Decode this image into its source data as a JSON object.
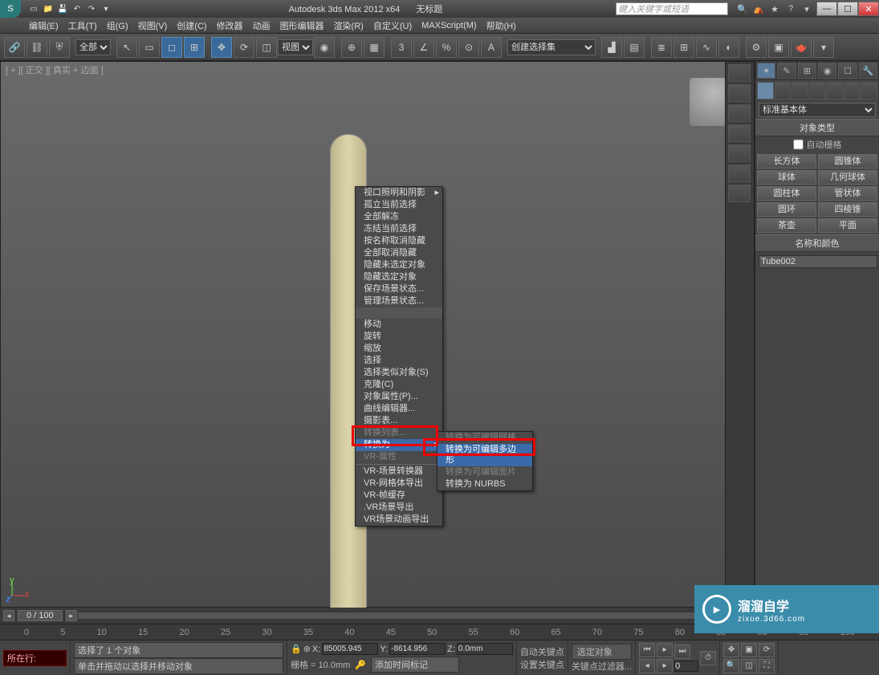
{
  "titlebar": {
    "title": "Autodesk 3ds Max  2012 x64",
    "doc": "无标题",
    "search_placeholder": "键入关键字或短语"
  },
  "menubar": [
    "编辑(E)",
    "工具(T)",
    "组(G)",
    "视图(V)",
    "创建(C)",
    "修改器",
    "动画",
    "图形编辑器",
    "渲染(R)",
    "自定义(U)",
    "MAXScript(M)",
    "帮助(H)"
  ],
  "toolbar": {
    "sel_filter": "全部",
    "ref_coord": "视图",
    "named_sets": "创建选择集"
  },
  "viewport": {
    "label": "[ + ][ 正交 ][ 真实 + 边面 ]"
  },
  "contextmenu": {
    "g1": [
      "视口照明和阴影",
      "孤立当前选择",
      "全部解冻",
      "冻结当前选择",
      "按名称取消隐藏",
      "全部取消隐藏",
      "隐藏未选定对象",
      "隐藏选定对象",
      "保存场景状态...",
      "管理场景状态..."
    ],
    "g2": [
      "移动",
      "旋转",
      "缩放",
      "选择",
      "选择类似对象(S)",
      "克隆(C)",
      "对象属性(P)...",
      "曲线编辑器...",
      "摄影表..."
    ],
    "g2b_hidden_top": "转换列表...",
    "g2b_highlight": "转换为",
    "g2b_hidden_bot": "VR-属性",
    "g3": [
      "VR-场景转换器",
      "VR-网格体导出",
      "VR-帧缓存",
      ".VR场景导出",
      "VR场景动画导出"
    ],
    "sub_hidden_top": "转换为可编辑网格",
    "sub_highlight": "转换为可编辑多边形",
    "sub_hidden_mid": "转换为可编辑面片",
    "sub_last": "转换为 NURBS"
  },
  "panel": {
    "category": "标准基本体",
    "roll_objtype": "对象类型",
    "autogrid": "自动栅格",
    "prims": [
      "长方体",
      "圆锥体",
      "球体",
      "几何球体",
      "圆柱体",
      "管状体",
      "圆环",
      "四棱锥",
      "茶壶",
      "平面"
    ],
    "roll_namecolor": "名称和颜色",
    "object_name": "Tube002"
  },
  "time": {
    "frame": "0 / 100",
    "marks": [
      "0",
      "5",
      "10",
      "15",
      "20",
      "25",
      "30",
      "35",
      "40",
      "45",
      "50",
      "55",
      "60",
      "65",
      "70",
      "75",
      "80",
      "85",
      "90",
      "95",
      "100"
    ]
  },
  "status": {
    "mscript_label": "所在行:",
    "sel": "选择了 1 个对象",
    "prompt": "单击并拖动以选择并移动对象",
    "x": "85005.945",
    "y": "-8614.956",
    "z": "0.0mm",
    "grid": "栅格 = 10.0mm",
    "autokey": "自动关键点",
    "setkey": "设置关键点",
    "selonly": "选定对象",
    "keyfilter": "关键点过滤器...",
    "addtime": "添加时间标记",
    "curframe": "0"
  },
  "watermark": {
    "name": "溜溜自学",
    "url": "zixue.3d66.com"
  }
}
